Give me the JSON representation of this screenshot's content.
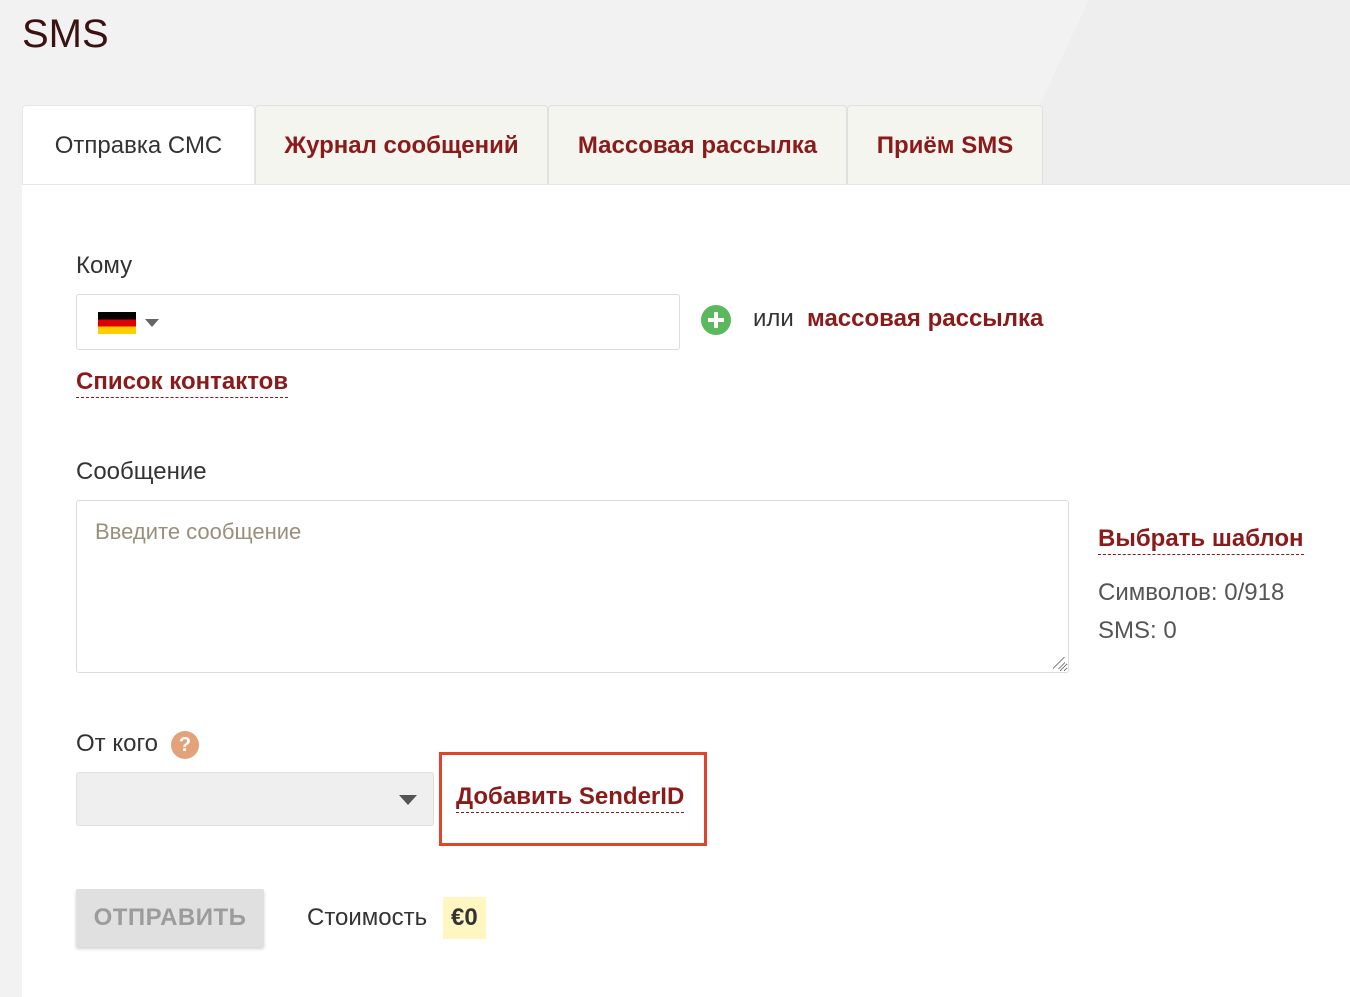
{
  "page": {
    "title": "SMS"
  },
  "tabs": [
    {
      "label": "Отправка СМС",
      "active": true
    },
    {
      "label": "Журнал сообщений",
      "active": false
    },
    {
      "label": "Массовая рассылка",
      "active": false
    },
    {
      "label": "Приём SMS",
      "active": false
    }
  ],
  "to": {
    "label": "Кому",
    "country_flag": "germany-flag",
    "phone_value": "",
    "or_text": "или",
    "bulk_link": "массовая рассылка",
    "contacts_link": "Список контактов"
  },
  "message": {
    "label": "Сообщение",
    "placeholder": "Введите сообщение",
    "value": "",
    "template_link": "Выбрать шаблон",
    "chars_counter": "Символов: 0/918",
    "sms_counter": "SMS: 0"
  },
  "from": {
    "label": "От кого",
    "help_symbol": "?",
    "selected_value": "",
    "add_sender_link": "Добавить SenderID"
  },
  "footer": {
    "send_button": "ОТПРАВИТЬ",
    "cost_label": "Стоимость",
    "cost_value": "€0"
  },
  "colors": {
    "accent": "#8b1a1a",
    "highlight_border": "#e0442b",
    "add_icon": "#5cb85c",
    "help_icon": "#e3a27a",
    "cost_bg": "#fff6c2"
  }
}
